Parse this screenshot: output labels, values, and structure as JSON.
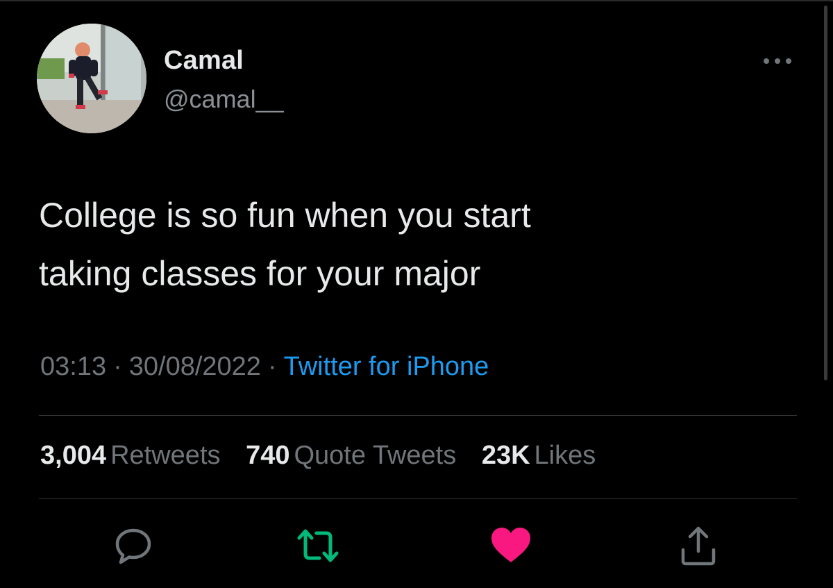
{
  "tweet": {
    "author": {
      "display_name": "Camal",
      "handle": "@camal__",
      "avatar_icon": "profile-photo"
    },
    "text_lines": [
      "College is so fun when you start",
      "taking classes for your major"
    ],
    "time": "03:13",
    "date": "30/08/2022",
    "separator": "·",
    "source": "Twitter for iPhone",
    "stats": {
      "retweets_count": "3,004",
      "retweets_label": "Retweets",
      "quotes_count": "740",
      "quotes_label": "Quote Tweets",
      "likes_count": "23K",
      "likes_label": "Likes"
    },
    "actions": {
      "reply_icon": "reply-icon",
      "retweet_icon": "retweet-icon",
      "like_icon": "heart-icon",
      "share_icon": "share-icon"
    }
  },
  "colors": {
    "background": "#000000",
    "text": "#e7e9ea",
    "secondary_text": "#71767b",
    "link": "#1d9bf0",
    "retweet_green": "#00ba7c",
    "like_pink": "#f91880"
  }
}
